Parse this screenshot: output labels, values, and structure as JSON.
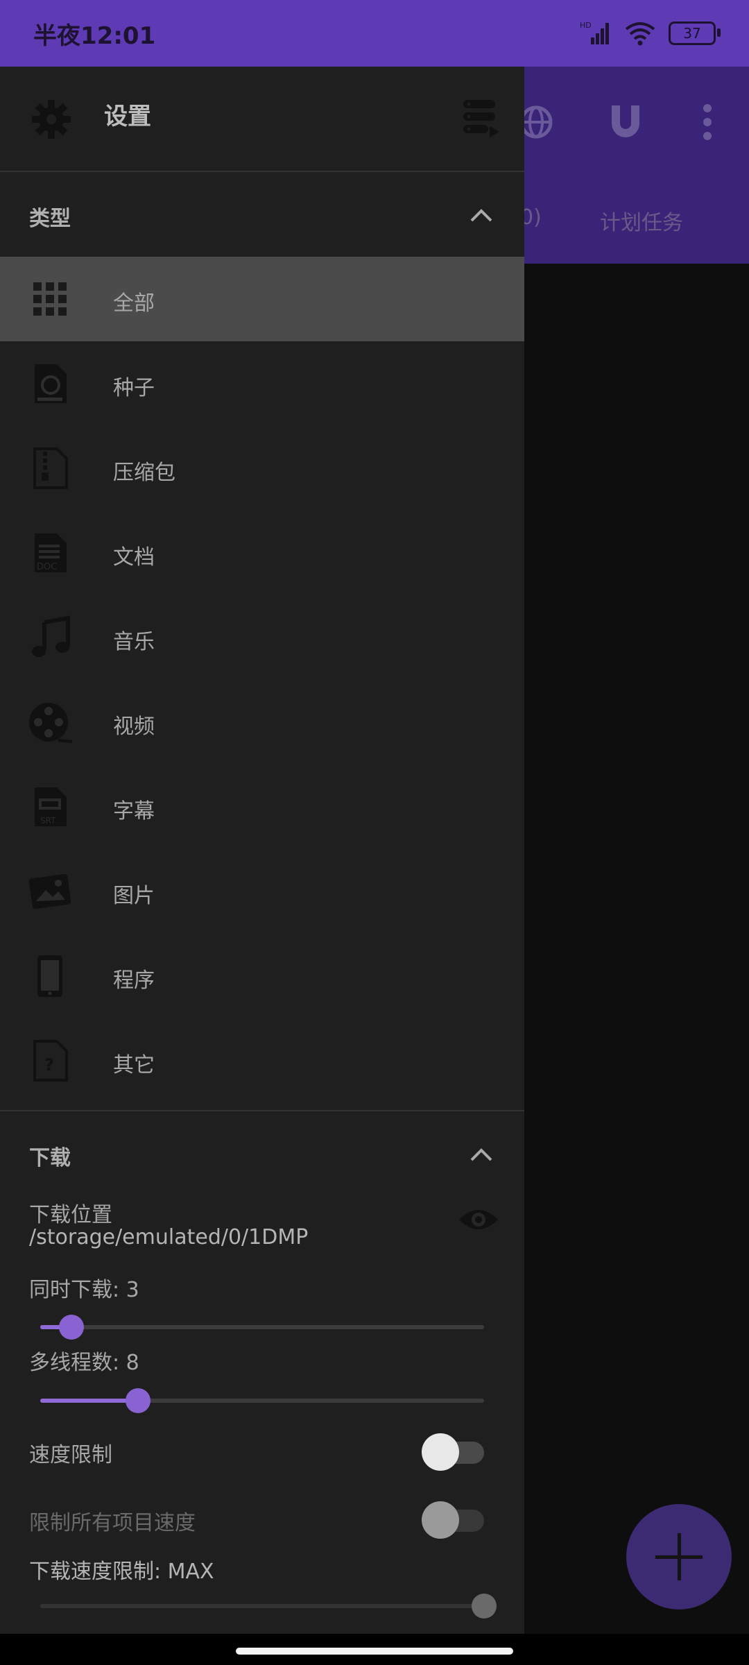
{
  "status_bar": {
    "time": "半夜12:01",
    "battery": "37",
    "network": "HD"
  },
  "app_bar": {
    "tabs": [
      "0)",
      "计划任务"
    ],
    "icons": [
      "globe-icon",
      "magnet-icon",
      "more-vert-icon"
    ]
  },
  "drawer": {
    "header": {
      "title": "设置",
      "icon": "gear-icon",
      "action_icon": "server-icon"
    },
    "types_section": {
      "title": "类型",
      "expanded": true,
      "items": [
        {
          "label": "全部",
          "icon": "grid-icon",
          "active": true
        },
        {
          "label": "种子",
          "icon": "torrent-file-icon"
        },
        {
          "label": "压缩包",
          "icon": "zip-file-icon"
        },
        {
          "label": "文档",
          "icon": "doc-file-icon"
        },
        {
          "label": "音乐",
          "icon": "music-note-icon"
        },
        {
          "label": "视频",
          "icon": "film-reel-icon"
        },
        {
          "label": "字幕",
          "icon": "subtitle-file-icon"
        },
        {
          "label": "图片",
          "icon": "image-icon"
        },
        {
          "label": "程序",
          "icon": "phone-icon"
        },
        {
          "label": "其它",
          "icon": "unknown-file-icon"
        }
      ]
    },
    "download_section": {
      "title": "下载",
      "expanded": true,
      "location_label": "下载位置",
      "location_path": "/storage/emulated/0/1DMP",
      "concurrent_label": "同时下载:  3",
      "concurrent_value": 3,
      "concurrent_fraction": 0.07,
      "threads_label": "多线程数: 8",
      "threads_value": 8,
      "threads_fraction": 0.22,
      "speed_limit_label": "速度限制",
      "speed_limit_on": false,
      "limit_all_label": "限制所有项目速度",
      "limit_all_on": false,
      "limit_all_enabled": false,
      "download_speed_label": "下载速度限制: MAX"
    }
  },
  "colors": {
    "accent": "#8a63d2",
    "status_bar": "#5e3ab5",
    "drawer_bg": "#1f1f1f",
    "active_item": "#4b4b4b"
  }
}
